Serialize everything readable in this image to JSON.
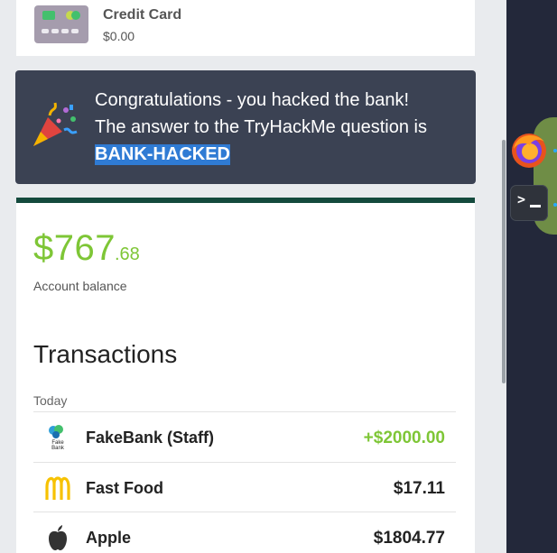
{
  "credit_card": {
    "name": "Credit Card",
    "balance": "$0.00"
  },
  "alert": {
    "line1": "Congratulations - you hacked the bank!",
    "line2": "The answer to the TryHackMe question is",
    "answer": "BANK-HACKED"
  },
  "account": {
    "balance_whole": "$767",
    "balance_cents": ".68",
    "balance_label": "Account balance"
  },
  "transactions": {
    "title": "Transactions",
    "day": "Today",
    "items": [
      {
        "name": "FakeBank (Staff)",
        "amount": "+$2000.00",
        "icon": "fakebank-logo-icon",
        "logo_text": [
          "Fake",
          "Bank"
        ]
      },
      {
        "name": "Fast Food",
        "amount": "$17.11",
        "icon": "mcdonalds-logo-icon"
      },
      {
        "name": "Apple",
        "amount": "$1804.77",
        "icon": "apple-logo-icon"
      }
    ]
  },
  "dock": {
    "apps": [
      "firefox-icon",
      "terminal-icon"
    ],
    "terminal_prompt": ">"
  },
  "colors": {
    "accent_green": "#7ec636",
    "alert_bg": "#3b4253",
    "highlight": "#2f7bd4",
    "card_border": "#144a3d"
  }
}
